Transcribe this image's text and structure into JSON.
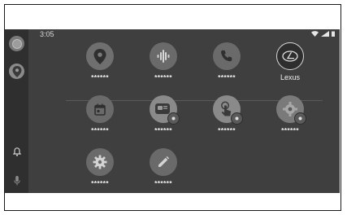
{
  "status": {
    "time": "3:05"
  },
  "apps": [
    {
      "id": "maps",
      "label": "******",
      "icon": "map-pin-icon"
    },
    {
      "id": "podcasts",
      "label": "******",
      "icon": "audio-wave-icon"
    },
    {
      "id": "phone",
      "label": "******",
      "icon": "phone-icon"
    },
    {
      "id": "lexus",
      "label": "Lexus",
      "icon": "lexus-logo-icon"
    },
    {
      "id": "calendar",
      "label": "******",
      "icon": "calendar-icon"
    },
    {
      "id": "app-messaging",
      "label": "******",
      "icon": "chat-icon"
    },
    {
      "id": "app-touch",
      "label": "******",
      "icon": "touch-icon"
    },
    {
      "id": "app-settings-badge",
      "label": "******",
      "icon": "gear-badge-icon"
    },
    {
      "id": "settings",
      "label": "******",
      "icon": "gear-icon"
    },
    {
      "id": "notes",
      "label": "******",
      "icon": "pencil-icon"
    }
  ],
  "colors": {
    "screen_bg": "#3f3f3f",
    "rail_bg": "#2f2f2f",
    "icon_bg": "#6a6a6a",
    "text": "#f0f0f0"
  }
}
